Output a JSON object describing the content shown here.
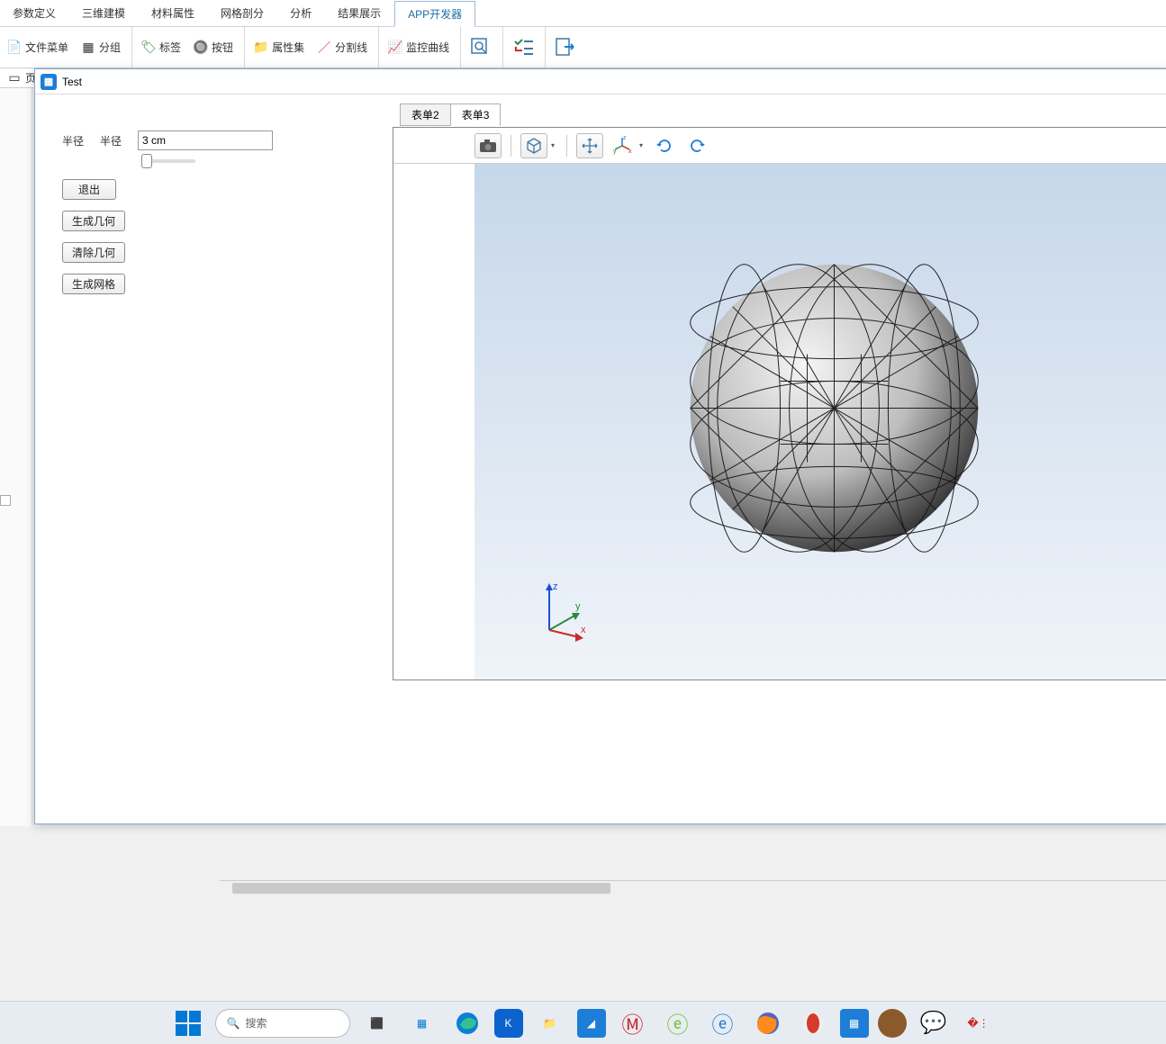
{
  "menu": {
    "tabs": [
      "参数定义",
      "三维建模",
      "材料属性",
      "网格剖分",
      "分析",
      "结果展示",
      "APP开发器"
    ],
    "active_index": 6
  },
  "ribbon": {
    "file_menu": "文件菜单",
    "group": "分组",
    "page": "页",
    "label": "标签",
    "button": "按钮",
    "propset": "属性集",
    "divider": "分割线",
    "monitor_curve": "监控曲线"
  },
  "test_window": {
    "title": "Test",
    "param_group_label": "半径",
    "param_label": "半径",
    "param_value": "3 cm",
    "buttons": {
      "exit": "退出",
      "gen_geometry": "生成几何",
      "clear_geometry": "清除几何",
      "gen_mesh": "生成网格"
    },
    "form_tabs": [
      "表单2",
      "表单3"
    ],
    "active_form_index": 1
  },
  "viewer_icons": {
    "camera": "camera-icon",
    "cube": "cube-icon",
    "move": "move-icon",
    "axes": "axes-icon",
    "rotate_cw": "rotate-cw-icon",
    "rotate_ccw": "rotate-ccw-icon"
  },
  "axis_labels": {
    "x": "x",
    "y": "y",
    "z": "z"
  },
  "taskbar": {
    "search_placeholder": "搜索"
  }
}
